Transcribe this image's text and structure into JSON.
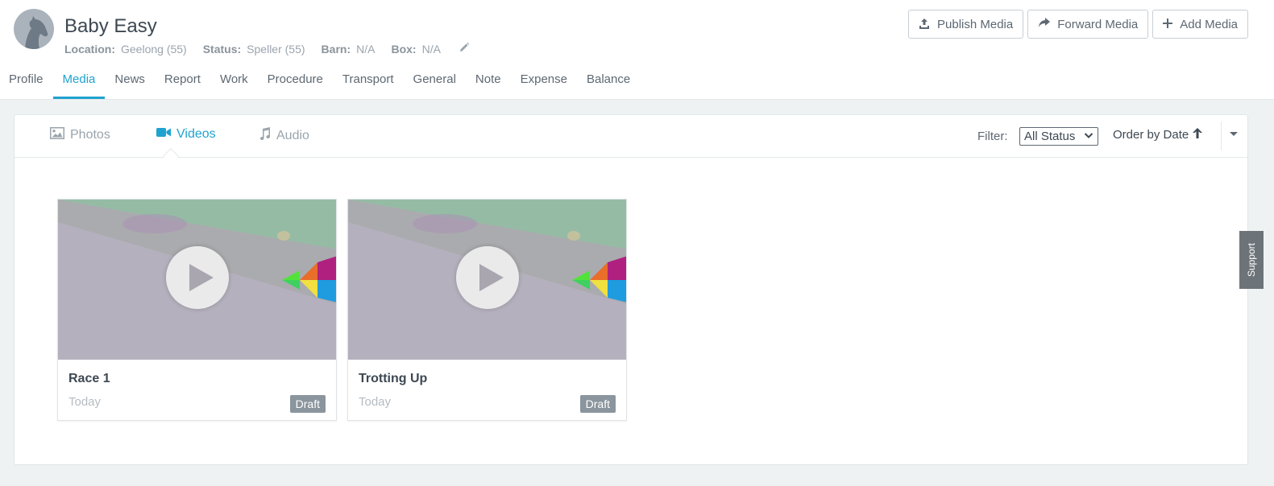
{
  "horse": {
    "name": "Baby Easy",
    "location_label": "Location:",
    "location_value": "Geelong (55)",
    "status_label": "Status:",
    "status_value": "Speller (55)",
    "barn_label": "Barn:",
    "barn_value": "N/A",
    "box_label": "Box:",
    "box_value": "N/A"
  },
  "header_buttons": {
    "publish": "Publish Media",
    "forward": "Forward Media",
    "add": "Add Media"
  },
  "nav": {
    "tabs": [
      "Profile",
      "Media",
      "News",
      "Report",
      "Work",
      "Procedure",
      "Transport",
      "General",
      "Note",
      "Expense",
      "Balance"
    ],
    "active": "Media"
  },
  "media_tabs": {
    "photos": "Photos",
    "videos": "Videos",
    "audio": "Audio",
    "active": "Videos"
  },
  "filter": {
    "label": "Filter:",
    "selected": "All Status",
    "order_label": "Order by Date"
  },
  "videos": [
    {
      "title": "Race 1",
      "date": "Today",
      "status": "Draft"
    },
    {
      "title": "Trotting Up",
      "date": "Today",
      "status": "Draft"
    }
  ],
  "support_label": "Support",
  "colors": {
    "accent": "#1fa2d0",
    "badge": "#8a959d",
    "background": "#eff2f3"
  }
}
